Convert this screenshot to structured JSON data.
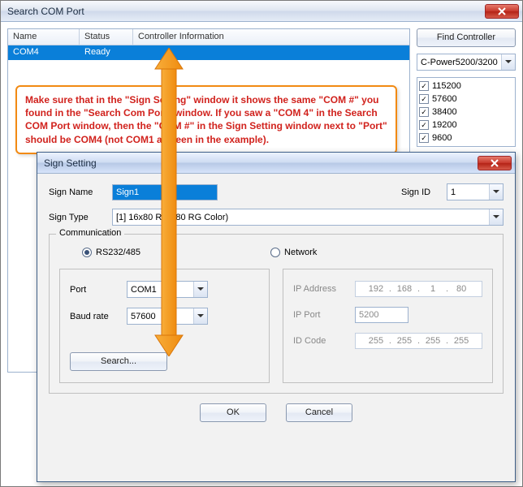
{
  "win1": {
    "title": "Search COM Port",
    "columns": {
      "name": "Name",
      "status": "Status",
      "ctrl": "Controller Information"
    },
    "rows": [
      {
        "name": "COM4",
        "status": "Ready",
        "ctrl": ""
      }
    ],
    "find_button": "Find Controller",
    "device_dropdown": "C-Power5200/3200",
    "baud_options": [
      "115200",
      "57600",
      "38400",
      "19200",
      "9600"
    ]
  },
  "callout": "Make sure that in the \"Sign Setting\" window it shows the same \"COM #\" you found in the \"Search Com Port\" window. If you saw a \"COM 4\" in the Search COM Port window, then the \"COM #\" in the Sign Setting window next to \"Port\" should be COM4 (not COM1 as seen in the example).",
  "win2": {
    "title": "Sign Setting",
    "labels": {
      "sign_name": "Sign Name",
      "sign_id": "Sign ID",
      "sign_type": "Sign Type",
      "communication": "Communication",
      "rs": "RS232/485",
      "network": "Network",
      "port": "Port",
      "baud": "Baud rate",
      "search": "Search...",
      "ip_addr": "IP Address",
      "ip_port": "IP Port",
      "id_code": "ID Code",
      "ok": "OK",
      "cancel": "Cancel"
    },
    "values": {
      "sign_name": "Sign1",
      "sign_id": "1",
      "sign_type": "[1] 16x80 RG     x80 RG Color)",
      "port": "COM1",
      "baud": "57600",
      "ip_addr": [
        "192",
        "168",
        "1",
        "80"
      ],
      "ip_port": "5200",
      "id_code": [
        "255",
        "255",
        "255",
        "255"
      ]
    }
  }
}
